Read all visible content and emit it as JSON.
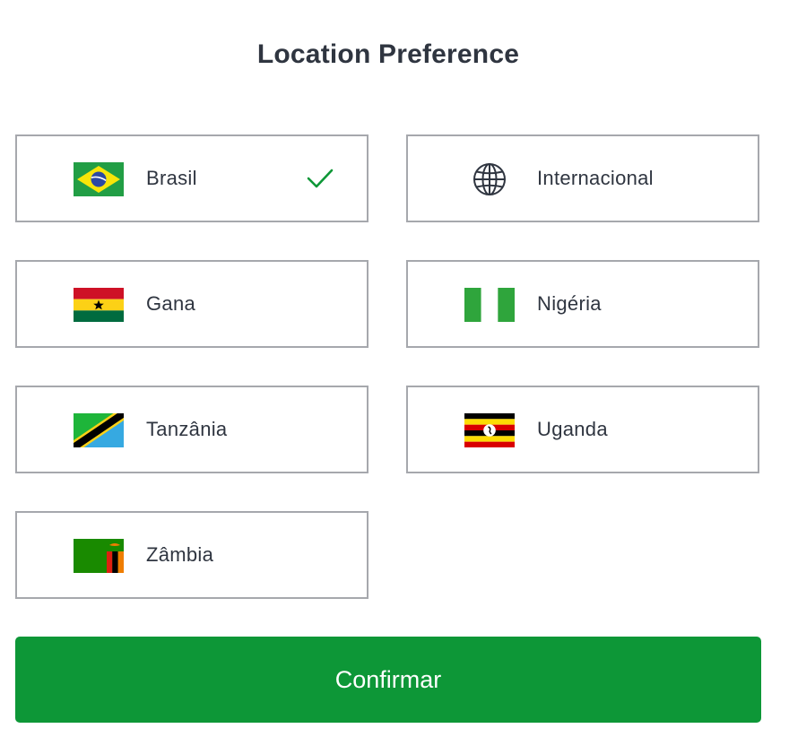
{
  "header": {
    "title": "Location Preference"
  },
  "options": [
    {
      "label": "Brasil",
      "icon": "brazil-flag-icon",
      "selected": true
    },
    {
      "label": "Internacional",
      "icon": "globe-icon",
      "selected": false
    },
    {
      "label": "Gana",
      "icon": "ghana-flag-icon",
      "selected": false
    },
    {
      "label": "Nigéria",
      "icon": "nigeria-flag-icon",
      "selected": false
    },
    {
      "label": "Tanzânia",
      "icon": "tanzania-flag-icon",
      "selected": false
    },
    {
      "label": "Uganda",
      "icon": "uganda-flag-icon",
      "selected": false
    },
    {
      "label": "Zâmbia",
      "icon": "zambia-flag-icon",
      "selected": false
    }
  ],
  "selected_icon": "checkmark-icon",
  "footer": {
    "confirm_label": "Confirmar"
  },
  "colors": {
    "accent": "#0d9737",
    "card_border": "#a6a8ad",
    "text": "#2f3540"
  }
}
